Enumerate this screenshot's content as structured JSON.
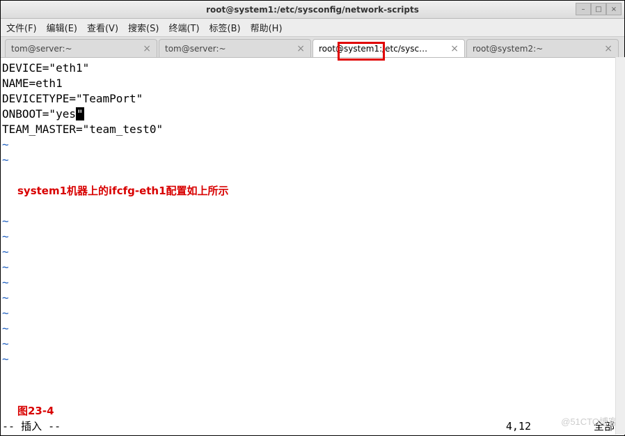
{
  "window": {
    "title": "root@system1:/etc/sysconfig/network-scripts"
  },
  "menubar": {
    "items": [
      "文件(F)",
      "编辑(E)",
      "查看(V)",
      "搜索(S)",
      "终端(T)",
      "标签(B)",
      "帮助(H)"
    ]
  },
  "tabs": [
    {
      "label": "tom@server:~",
      "active": false
    },
    {
      "label": "tom@server:~",
      "active": false
    },
    {
      "label": "root@system1:/etc/sysc…",
      "active": true
    },
    {
      "label": "root@system2:~",
      "active": false
    }
  ],
  "editor": {
    "content_lines": [
      "DEVICE=\"eth1\"",
      "NAME=eth1",
      "DEVICETYPE=\"TeamPort\"",
      "ONBOOT=\"yes\"",
      "TEAM_MASTER=\"team_test0\""
    ],
    "cursor_line_index": 3,
    "cursor_char": "\"",
    "tilde": "~"
  },
  "annotation": {
    "text": "system1机器上的ifcfg-eth1配置如上所示"
  },
  "figure": {
    "label": "图23-4"
  },
  "status": {
    "mode": "-- 插入 --",
    "position": "4,12",
    "scroll": "全部"
  },
  "watermark": "@51CTO博客"
}
